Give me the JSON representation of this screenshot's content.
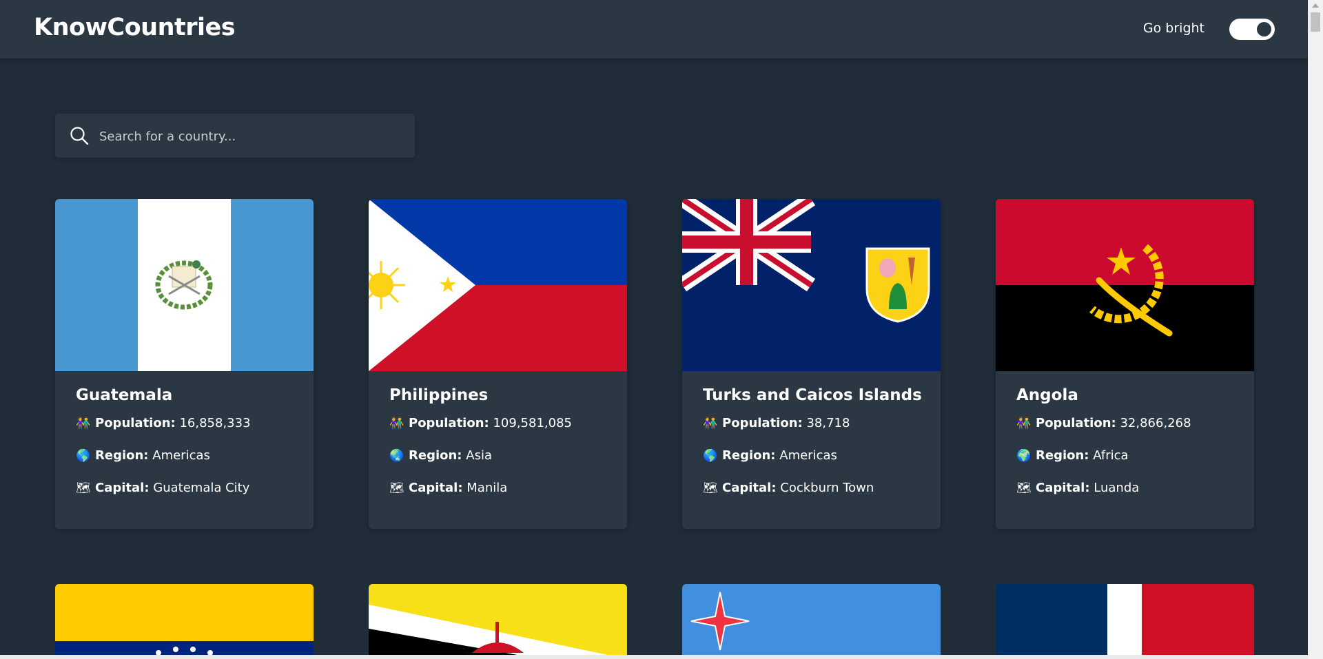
{
  "header": {
    "app_title": "KnowCountries",
    "theme_toggle_label": "Go bright"
  },
  "search": {
    "placeholder": "Search for a country..."
  },
  "labels": {
    "population": "Population:",
    "region": "Region:",
    "capital": "Capital:"
  },
  "icons": {
    "population": "family-icon",
    "region": "globe-icon",
    "capital": "world-map-icon",
    "search": "search-icon"
  },
  "countries": [
    {
      "name": "Guatemala",
      "population": "16,858,333",
      "region": "Americas",
      "capital": "Guatemala City"
    },
    {
      "name": "Philippines",
      "population": "109,581,085",
      "region": "Asia",
      "capital": "Manila"
    },
    {
      "name": "Turks and Caicos Islands",
      "population": "38,718",
      "region": "Americas",
      "capital": "Cockburn Town"
    },
    {
      "name": "Angola",
      "population": "32,866,268",
      "region": "Africa",
      "capital": "Luanda"
    }
  ],
  "partial_cards": [
    "Venezuela flag",
    "Brunei flag",
    "Aruba flag",
    "Dominican Republic flag"
  ],
  "colors": {
    "background": "#202c37",
    "surface": "#2b3844",
    "text": "#ffffff"
  }
}
